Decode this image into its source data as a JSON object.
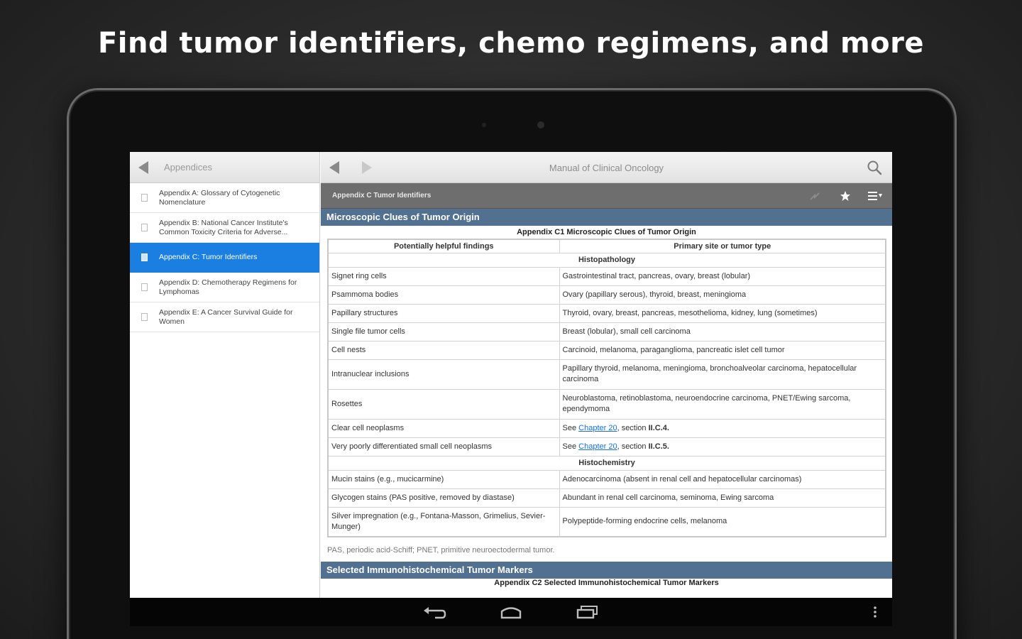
{
  "headline": "Find tumor identifiers, chemo regimens, and more",
  "left_pane": {
    "title": "Appendices",
    "items": [
      {
        "label": "Appendix A: Glossary of Cytogenetic Nomenclature",
        "selected": false
      },
      {
        "label": "Appendix B: National Cancer Institute's Common Toxicity Criteria for Adverse...",
        "selected": false
      },
      {
        "label": "Appendix C: Tumor Identifiers",
        "selected": true
      },
      {
        "label": "Appendix D: Chemotherapy Regimens for Lymphomas",
        "selected": false
      },
      {
        "label": "Appendix E: A Cancer Survival Guide for Women",
        "selected": false
      }
    ]
  },
  "right_pane": {
    "title": "Manual of Clinical Oncology",
    "toolbar_title": "Appendix C Tumor Identifiers",
    "section1_title": "Microscopic Clues of Tumor Origin",
    "table_caption": "Appendix C1 Microscopic Clues of Tumor Origin",
    "col1_header": "Potentially helpful findings",
    "col2_header": "Primary site or tumor type",
    "group1": "Histopathology",
    "group2": "Histochemistry",
    "rows1": [
      {
        "finding": "Signet ring cells",
        "site": "Gastrointestinal tract, pancreas, ovary, breast (lobular)"
      },
      {
        "finding": "Psammoma bodies",
        "site": "Ovary (papillary serous), thyroid, breast, meningioma"
      },
      {
        "finding": "Papillary structures",
        "site": "Thyroid, ovary, breast, pancreas, mesothelioma, kidney, lung (sometimes)"
      },
      {
        "finding": "Single file tumor cells",
        "site": "Breast (lobular), small cell carcinoma"
      },
      {
        "finding": "Cell nests",
        "site": "Carcinoid, melanoma, paraganglioma, pancreatic islet cell tumor"
      },
      {
        "finding": "Intranuclear inclusions",
        "site": "Papillary thyroid, melanoma, meningioma, bronchoalveolar carcinoma, hepatocellular carcinoma"
      },
      {
        "finding": "Rosettes",
        "site": "Neuroblastoma, retinoblastoma, neuroendocrine carcinoma, PNET/Ewing sarcoma, ependymoma"
      }
    ],
    "row_clear": {
      "finding": "Clear cell neoplasms",
      "see": "See ",
      "link": "Chapter 20",
      "rest": ", section ",
      "section": "II.C.4."
    },
    "row_poorly": {
      "finding": "Very poorly differentiated small cell neoplasms",
      "see": "See ",
      "link": "Chapter 20",
      "rest": ", section ",
      "section": "II.C.5."
    },
    "rows2": [
      {
        "finding": "Mucin stains (e.g., mucicarmine)",
        "site": "Adenocarcinoma (absent in renal cell and hepatocellular carcinomas)"
      },
      {
        "finding": "Glycogen stains (PAS positive, removed by diastase)",
        "site": "Abundant in renal cell carcinoma, seminoma, Ewing sarcoma"
      },
      {
        "finding": "Silver impregnation (e.g., Fontana-Masson, Grimelius, Sevier-Munger)",
        "site": "Polypeptide-forming endocrine cells, melanoma"
      }
    ],
    "footnote": "PAS, periodic acid-Schiff; PNET, primitive neuroectodermal tumor.",
    "section2_title": "Selected Immunohistochemical Tumor Markers",
    "caption2": "Appendix C2 Selected Immunohistochemical Tumor Markers"
  },
  "icons": {
    "back": "back-arrow-icon",
    "forward": "forward-arrow-icon",
    "search": "search-icon",
    "share": "share-icon",
    "bookmark": "star-icon",
    "toc": "toc-icon",
    "sys_back": "back-nav-icon",
    "sys_home": "home-icon",
    "sys_recents": "recents-icon",
    "sys_menu": "overflow-menu-icon"
  },
  "colors": {
    "selected": "#1a7fe0",
    "section_bar": "#52708f",
    "toolbar": "#6e6e6e",
    "link": "#1a6fd8"
  }
}
